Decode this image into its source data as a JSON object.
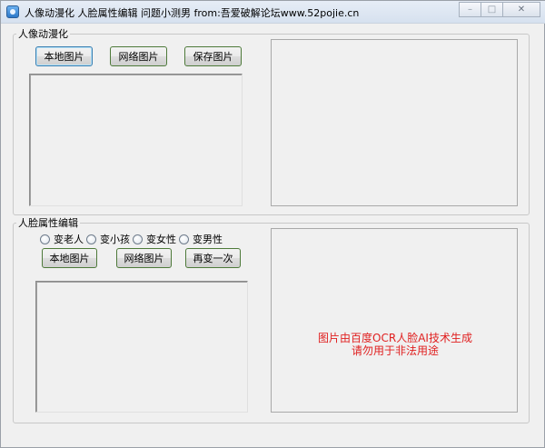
{
  "window": {
    "title": "人像动漫化 人脸属性编辑 问题小测男 from:吾爱破解论坛www.52pojie.cn",
    "icon": "app-icon",
    "controls": {
      "minimize": "–",
      "maximize": "□",
      "close": "✕"
    }
  },
  "anime_group": {
    "legend": "人像动漫化",
    "buttons": {
      "local": "本地图片",
      "network": "网络图片",
      "save": "保存图片"
    }
  },
  "face_group": {
    "legend": "人脸属性编辑",
    "options": [
      {
        "label": "变老人",
        "selected": false
      },
      {
        "label": "变小孩",
        "selected": false
      },
      {
        "label": "变女性",
        "selected": false
      },
      {
        "label": "变男性",
        "selected": false
      }
    ],
    "buttons": {
      "local": "本地图片",
      "network": "网络图片",
      "again": "再变一次"
    },
    "notice_line1": "图片由百度OCR人脸AI技术生成",
    "notice_line2": "请勿用于非法用途",
    "notice_color": "#e02020"
  }
}
